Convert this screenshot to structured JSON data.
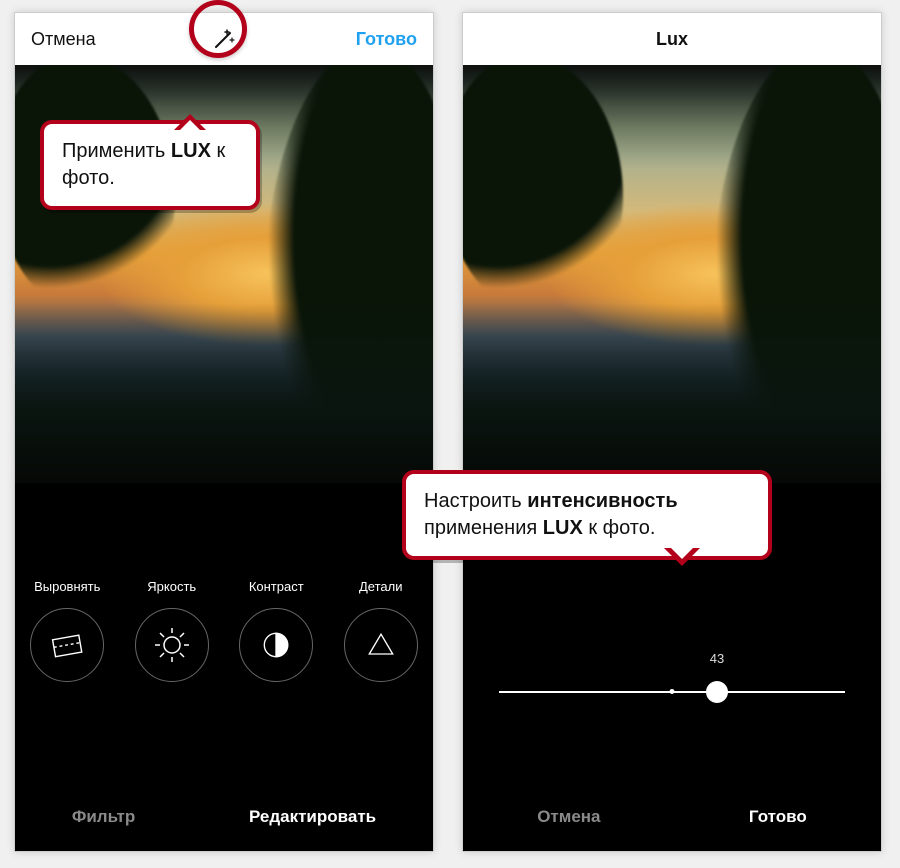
{
  "left_screen": {
    "header": {
      "cancel": "Отмена",
      "done": "Готово",
      "wand_icon": "magic-wand"
    },
    "tools": [
      {
        "label": "Выровнять",
        "icon": "adjust-crop"
      },
      {
        "label": "Яркость",
        "icon": "brightness-sun"
      },
      {
        "label": "Контраст",
        "icon": "contrast-half"
      },
      {
        "label": "Детали",
        "icon": "structure-triangle"
      }
    ],
    "tabs": {
      "filter": "Фильтр",
      "edit": "Редактировать"
    }
  },
  "right_screen": {
    "header": {
      "title": "Lux"
    },
    "slider": {
      "value": "43"
    },
    "tabs": {
      "cancel": "Отмена",
      "done": "Готово"
    }
  },
  "callouts": {
    "c1_pre": "Применить ",
    "c1_bold": "LUX",
    "c1_post": " к фото.",
    "c2_pre": "Настроить ",
    "c2_b1": "интенсивность",
    "c2_mid": " применения ",
    "c2_b2": "LUX",
    "c2_post": " к фото."
  }
}
